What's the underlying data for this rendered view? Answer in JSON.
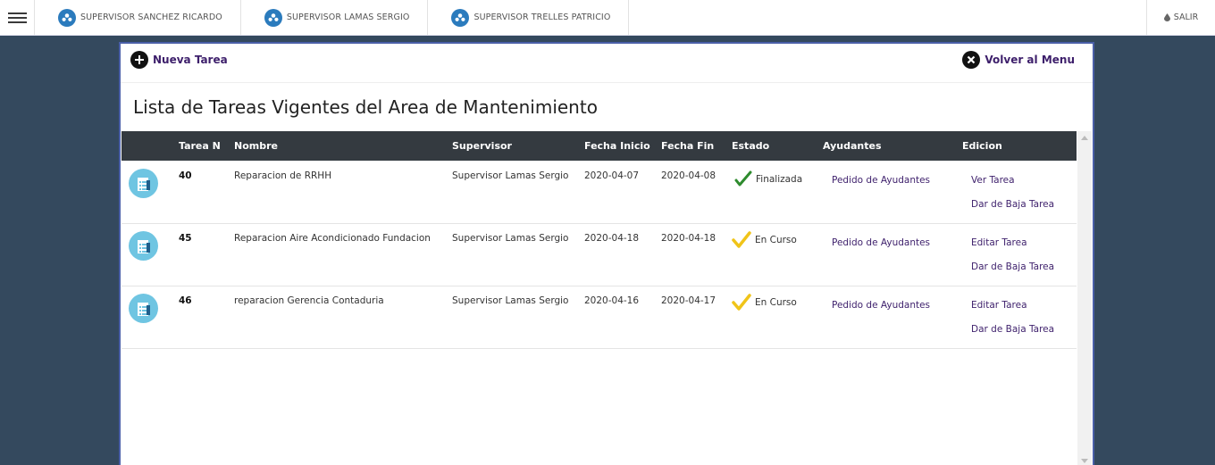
{
  "topbar": {
    "supervisors": [
      {
        "label": "SUPERVISOR SANCHEZ RICARDO",
        "icon": "user-group-icon"
      },
      {
        "label": "SUPERVISOR LAMAS SERGIO",
        "icon": "user-group-icon"
      },
      {
        "label": "SUPERVISOR TRELLES PATRICIO",
        "icon": "user-group-icon"
      }
    ],
    "logout_label": "SALIR"
  },
  "actions": {
    "new_task": "Nueva Tarea",
    "back_to_menu": "Volver al Menu"
  },
  "page_title": "Lista de Tareas Vigentes del Area de Mantenimiento",
  "table": {
    "headers": [
      "Tarea N",
      "Nombre",
      "Supervisor",
      "Fecha Inicio",
      "Fecha Fin",
      "Estado",
      "Ayudantes",
      "Edicion"
    ],
    "rows": [
      {
        "num": "40",
        "name": "Reparacion de RRHH",
        "supervisor": "Supervisor Lamas Sergio",
        "start": "2020-04-07",
        "end": "2020-04-08",
        "status": "Finalizada",
        "status_color": "#2e8b2e",
        "helpers": "Pedido de Ayudantes",
        "edit": "Ver Tarea",
        "delete": "Dar de Baja Tarea"
      },
      {
        "num": "45",
        "name": "Reparacion Aire Acondicionado Fundacion",
        "supervisor": "Supervisor Lamas Sergio",
        "start": "2020-04-18",
        "end": "2020-04-18",
        "status": "En Curso",
        "status_color": "#f0c419",
        "helpers": "Pedido de Ayudantes",
        "edit": "Editar Tarea",
        "delete": "Dar de Baja Tarea"
      },
      {
        "num": "46",
        "name": "reparacion Gerencia Contaduria",
        "supervisor": "Supervisor Lamas Sergio",
        "start": "2020-04-16",
        "end": "2020-04-17",
        "status": "En Curso",
        "status_color": "#f0c419",
        "helpers": "Pedido de Ayudantes",
        "edit": "Editar Tarea",
        "delete": "Dar de Baja Tarea"
      }
    ]
  },
  "colors": {
    "background": "#34495e",
    "header_bar": "#343a40",
    "link": "#3d1f6b",
    "accent_blue": "#2b7bbd",
    "task_icon": "#6fc5e2"
  }
}
